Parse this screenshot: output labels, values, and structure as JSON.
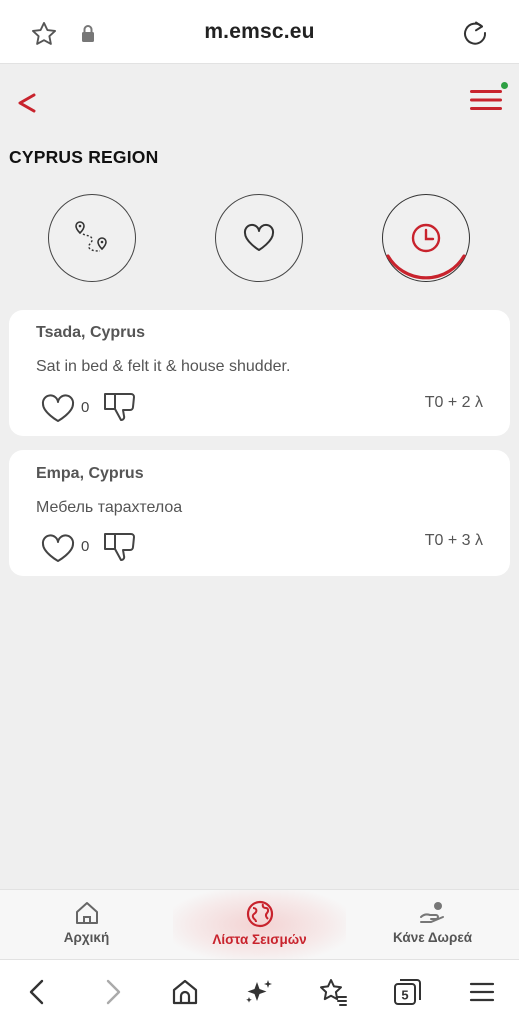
{
  "browser": {
    "url": "m.emsc.eu",
    "tab_count": "5"
  },
  "page": {
    "region_title": "CYPRUS REGION"
  },
  "view_buttons": [
    {
      "icon": "route-pins-icon",
      "active": false
    },
    {
      "icon": "heart-icon",
      "active": false
    },
    {
      "icon": "clock-icon",
      "active": true
    }
  ],
  "testimonies": [
    {
      "location": "Tsada, Cyprus",
      "text": "Sat in bed & felt it & house shudder.",
      "likes": "0",
      "time": "T0 + 2 λ"
    },
    {
      "location": "Empa, Cyprus",
      "text": "Мебель тарахтелоа",
      "likes": "0",
      "time": "T0 + 3 λ"
    }
  ],
  "bottom_tabs": [
    {
      "label": "Αρχική",
      "icon": "home-icon",
      "active": false
    },
    {
      "label": "Λίστα Σεισμών",
      "icon": "globe-icon",
      "active": true
    },
    {
      "label": "Κάνε Δωρεά",
      "icon": "donate-hand-icon",
      "active": false
    }
  ],
  "colors": {
    "accent": "#c8232d",
    "status_dot": "#2ea043",
    "background": "#efefef",
    "card": "#ffffff"
  }
}
